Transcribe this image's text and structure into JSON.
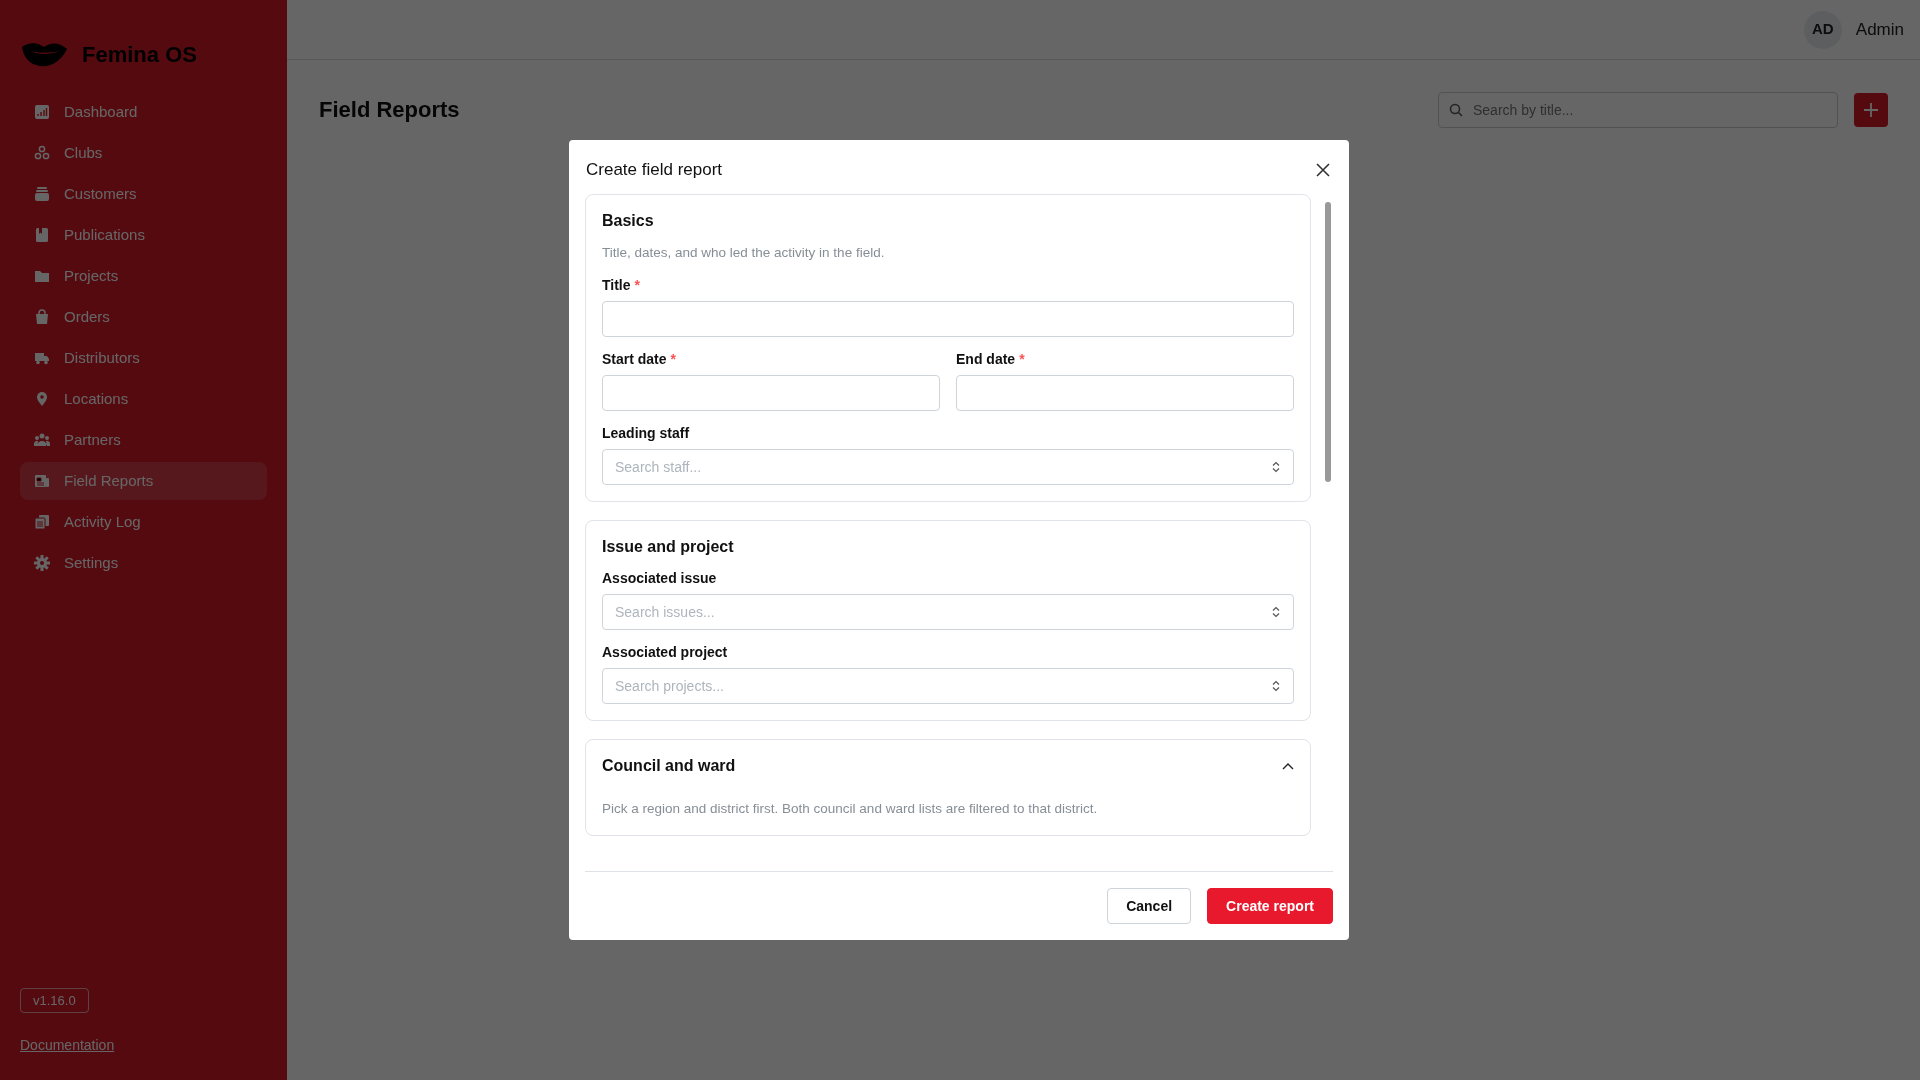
{
  "sidebar": {
    "brand": "Femina OS",
    "items": [
      {
        "label": "Dashboard",
        "selected": false
      },
      {
        "label": "Clubs",
        "selected": false
      },
      {
        "label": "Customers",
        "selected": false
      },
      {
        "label": "Publications",
        "selected": false
      },
      {
        "label": "Projects",
        "selected": false
      },
      {
        "label": "Orders",
        "selected": false
      },
      {
        "label": "Distributors",
        "selected": false
      },
      {
        "label": "Locations",
        "selected": false
      },
      {
        "label": "Partners",
        "selected": false
      },
      {
        "label": "Field Reports",
        "selected": true
      },
      {
        "label": "Activity Log",
        "selected": false
      },
      {
        "label": "Settings",
        "selected": false
      }
    ],
    "version": "v1.16.0",
    "docs_link": "Documentation"
  },
  "topbar": {
    "avatar": "AD",
    "user": "Admin"
  },
  "page": {
    "title": "Field Reports",
    "search": {
      "placeholder": "Search by title..."
    }
  },
  "modal": {
    "title": "Create field report",
    "sections": [
      {
        "title": "Basics",
        "description": "Title, dates, and who led the activity in the field.",
        "rows": [
          [
            {
              "label": "Title",
              "required_mark": "*",
              "kind": "text"
            }
          ],
          [
            {
              "label": "Start date",
              "required_mark": "*",
              "kind": "text"
            },
            {
              "label": "End date",
              "required_mark": "*",
              "kind": "text"
            }
          ],
          [
            {
              "label": "Leading staff",
              "kind": "combobox",
              "placeholder": "Search staff..."
            }
          ]
        ]
      },
      {
        "title": "Issue and project",
        "rows": [
          [
            {
              "label": "Associated issue",
              "kind": "combobox",
              "placeholder": "Search issues..."
            }
          ],
          [
            {
              "label": "Associated project",
              "kind": "combobox",
              "placeholder": "Search projects..."
            }
          ]
        ]
      },
      {
        "title": "Council and ward",
        "expanded": true,
        "description": "Pick a region and district first. Both council and ward lists are filtered to that district."
      }
    ],
    "buttons": [
      {
        "label": "Cancel",
        "kind": "secondary"
      },
      {
        "label": "Create report",
        "kind": "primary"
      }
    ]
  }
}
